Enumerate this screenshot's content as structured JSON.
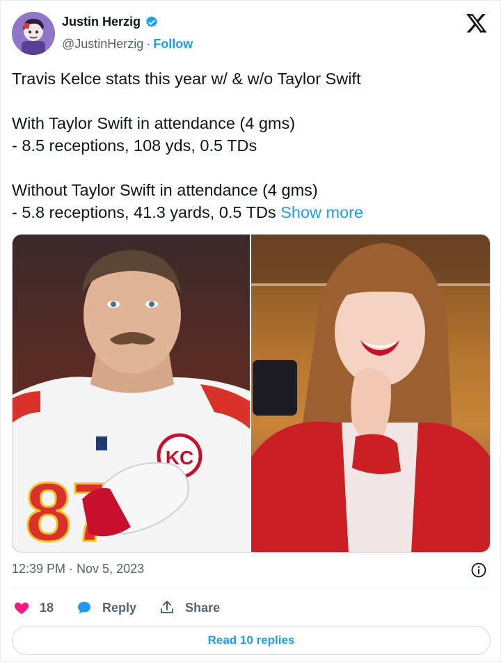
{
  "author": {
    "name": "Justin Herzig",
    "handle": "@JustinHerzig",
    "separator": "·",
    "follow_label": "Follow",
    "verified": true
  },
  "tweet": {
    "lines": [
      "Travis Kelce stats this year w/ & w/o Taylor Swift",
      "",
      "With Taylor Swift in attendance (4 gms)",
      "- 8.5 receptions, 108 yds, 0.5 TDs",
      "",
      "Without Taylor Swift in attendance (4 gms)",
      "- 5.8 receptions, 41.3 yards, 0.5 TDs"
    ],
    "show_more_label": "Show more"
  },
  "meta": {
    "timestamp": "12:39 PM · Nov 5, 2023"
  },
  "actions": {
    "like_count": "18",
    "reply_label": "Reply",
    "share_label": "Share"
  },
  "read_replies_label": "Read 10 replies",
  "icons": {
    "verified": "verified-badge-icon",
    "x_logo": "x-logo-icon",
    "info": "info-icon",
    "heart": "heart-icon",
    "reply": "reply-bubble-icon",
    "share": "share-upload-icon"
  },
  "colors": {
    "accent": "#1d9bf0",
    "like": "#f91880",
    "text": "#0f1419",
    "muted": "#536471"
  }
}
